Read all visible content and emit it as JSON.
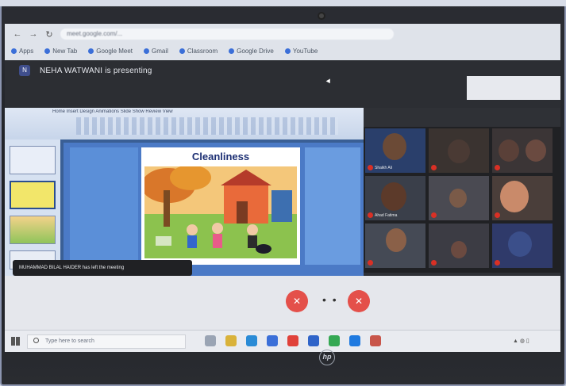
{
  "browser": {
    "url": "meet.google.com/...",
    "bookmarks": [
      "Apps",
      "New Tab",
      "Google Meet",
      "Gmail",
      "Classroom",
      "Google Drive",
      "YouTube"
    ]
  },
  "meet": {
    "presenter_initial": "N",
    "presenting_text": "NEHA WATWANI is presenting",
    "notice": "",
    "top_right": [
      "",
      "",
      ""
    ]
  },
  "presentation": {
    "slide_title": "Cleanliness",
    "ribbon_tabs": "Home  Insert  Design  Animations  Slide Show  Review  View"
  },
  "toast": {
    "text": "MUHAMMAD BILAL HAIDER has left the meeting"
  },
  "participants": [
    {
      "name": "Shaikh Ali"
    },
    {
      "name": ""
    },
    {
      "name": ""
    },
    {
      "name": "Ahad Fatima"
    },
    {
      "name": ""
    },
    {
      "name": ""
    },
    {
      "name": ""
    },
    {
      "name": ""
    },
    {
      "name": ""
    }
  ],
  "bottom_bar": {
    "meeting_code": "",
    "more_label": "• •",
    "right_label": ""
  },
  "taskbar": {
    "search_placeholder": "Type here to search"
  },
  "icons": {
    "mic": "mic-off-icon",
    "cam": "camera-off-icon",
    "windows": "windows-icon",
    "search": "search-icon",
    "logo": "hp-logo-icon"
  },
  "colors": {
    "control_red": "#e4504a",
    "meet_dark": "#2c2e33",
    "slide_title": "#1c2f73"
  }
}
